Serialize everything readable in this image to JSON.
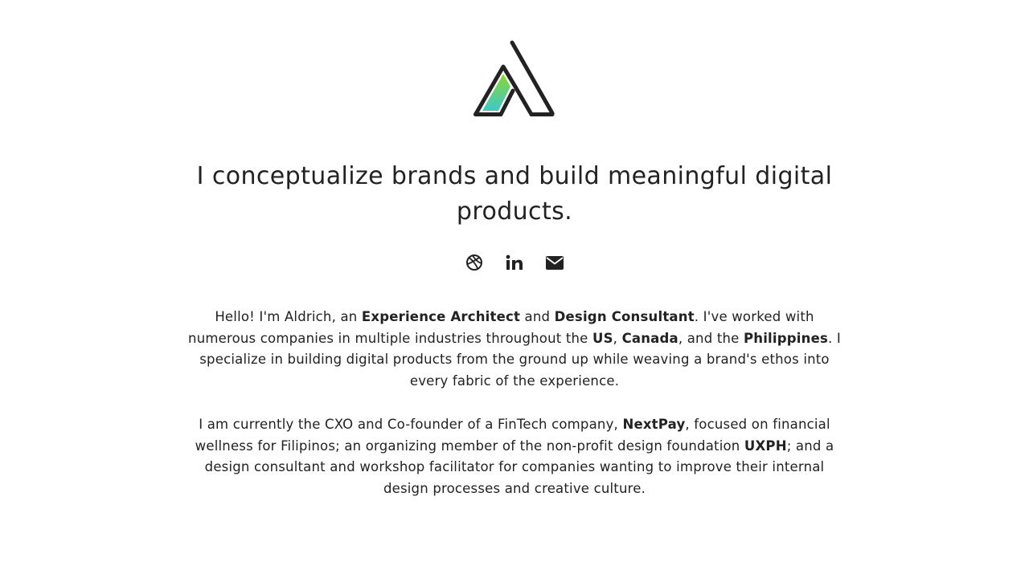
{
  "headline": "I conceptualize brands and build meaningful digital products.",
  "social": {
    "dribbble_icon": "dribbble-icon",
    "linkedin_icon": "linkedin-icon",
    "email_icon": "envelope-icon"
  },
  "bio_1": {
    "t1": "Hello! I'm Aldrich, an ",
    "b1": "Experience Architect",
    "t2": " and ",
    "b2": "Design Consultant",
    "t3": ". I've worked with numerous companies in multiple industries throughout the ",
    "b3": "US",
    "t4": ", ",
    "b4": "Canada",
    "t5": ", and the ",
    "b5": "Philippines",
    "t6": ". I specialize in building digital products from the ground up while weaving a brand's ethos into every fabric of the experience."
  },
  "bio_2": {
    "t1": "I am currently the CXO and Co-founder of a FinTech company, ",
    "b1": "NextPay",
    "t2": ", focused on financial wellness for Filipinos; an organizing member of the non-profit design foundation ",
    "b2": "UXPH",
    "t3": "; and a design consultant and workshop facilitator for companies wanting to improve their internal design processes and creative culture."
  },
  "colors": {
    "text": "#222222",
    "logo_gradient_top": "#8cd632",
    "logo_gradient_bottom": "#3fc8c8"
  }
}
